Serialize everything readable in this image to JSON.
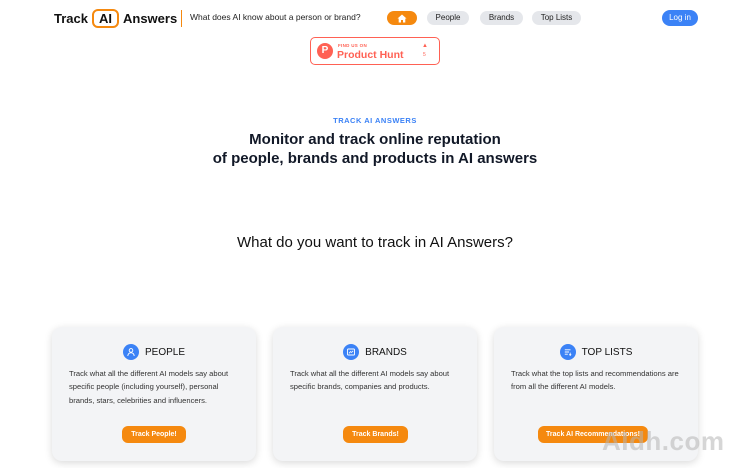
{
  "header": {
    "logo": {
      "left": "Track",
      "middle": "AI",
      "right": "Answers"
    },
    "tagline": "What does AI know about a person or brand?",
    "nav": {
      "home_icon": "home-icon",
      "people": "People",
      "brands": "Brands",
      "top_lists": "Top Lists"
    },
    "login": "Log in"
  },
  "product_hunt": {
    "small": "FIND US ON",
    "big": "Product Hunt",
    "letter": "P",
    "arrow": "▲",
    "count": "5"
  },
  "hero": {
    "eyebrow": "TRACK AI ANSWERS",
    "title_line1": "Monitor and track online reputation",
    "title_line2": "of people, brands and products in AI answers",
    "question": "What do you want to track in AI Answers?"
  },
  "cards": [
    {
      "title": "PEOPLE",
      "icon": "person-icon",
      "desc": "Track what all the different AI models say about specific people (including yourself), personal brands, stars, celebrities and influencers.",
      "button": "Track People!"
    },
    {
      "title": "BRANDS",
      "icon": "brand-icon",
      "desc": "Track what all the different AI models say about specific brands, companies and products.",
      "button": "Track Brands!"
    },
    {
      "title": "TOP LISTS",
      "icon": "list-icon",
      "desc": "Track what the top lists and recommendations are from all the different AI models.",
      "button": "Track AI Recommendations!"
    }
  ],
  "watermark": "AIdh.com",
  "colors": {
    "accent": "#f5890f",
    "primary": "#3b82f6",
    "product_hunt": "#ff6154"
  }
}
